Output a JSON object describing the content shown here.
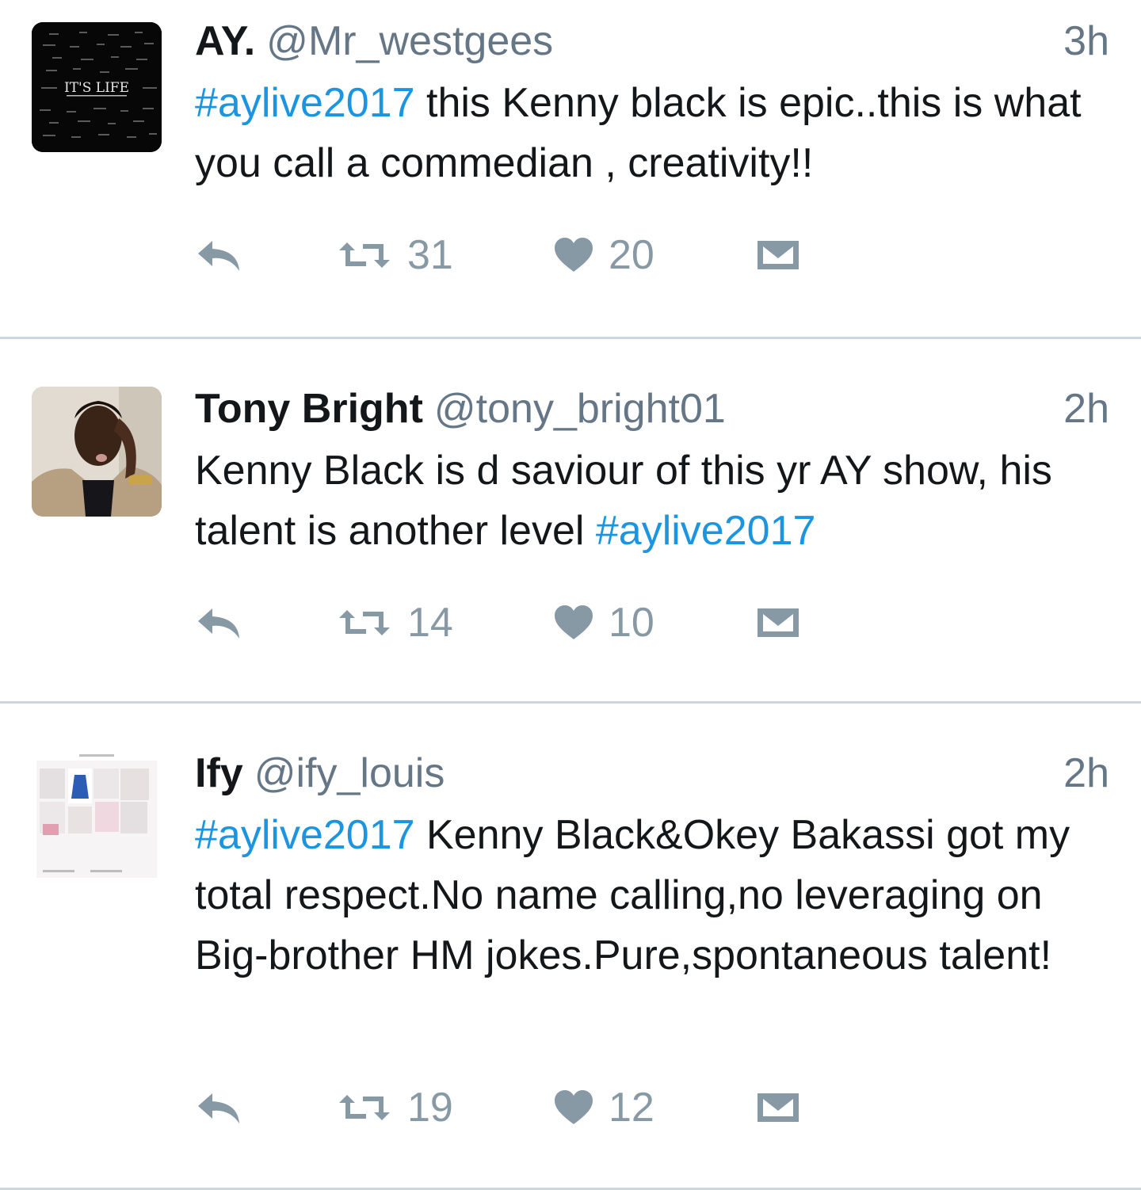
{
  "colors": {
    "hashtag": "#1b95e0",
    "handle": "#657786",
    "action": "#8899a6",
    "divider": "#ccd6dd"
  },
  "tweets": [
    {
      "name": "AY.",
      "handle": "@Mr_westgees",
      "time": "3h",
      "text_parts": [
        {
          "text": "#aylive2017",
          "hashtag": true
        },
        {
          "text": " this Kenny black is epic..this is what you call a commedian , creativity!!",
          "hashtag": false
        }
      ],
      "avatar_text": "IT'S LIFE",
      "retweets": "31",
      "likes": "20",
      "icons": {
        "reply": "reply-icon",
        "retweet": "retweet-icon",
        "like": "heart-icon",
        "dm": "envelope-icon"
      }
    },
    {
      "name": "Tony Bright",
      "handle": "@tony_bright01",
      "time": "2h",
      "text_parts": [
        {
          "text": "Kenny Black is d saviour of this yr AY show, his talent is another level ",
          "hashtag": false
        },
        {
          "text": "#aylive2017",
          "hashtag": true
        }
      ],
      "retweets": "14",
      "likes": "10",
      "icons": {
        "reply": "reply-icon",
        "retweet": "retweet-icon",
        "like": "heart-icon",
        "dm": "envelope-icon"
      }
    },
    {
      "name": "Ify",
      "handle": "@ify_louis",
      "time": "2h",
      "text_parts": [
        {
          "text": "#aylive2017",
          "hashtag": true
        },
        {
          "text": " Kenny Black&Okey Bakassi got my total respect.No name calling,no leveraging on Big-brother HM jokes.Pure,spontaneous talent!",
          "hashtag": false
        }
      ],
      "retweets": "19",
      "likes": "12",
      "icons": {
        "reply": "reply-icon",
        "retweet": "retweet-icon",
        "like": "heart-icon",
        "dm": "envelope-icon"
      }
    }
  ]
}
